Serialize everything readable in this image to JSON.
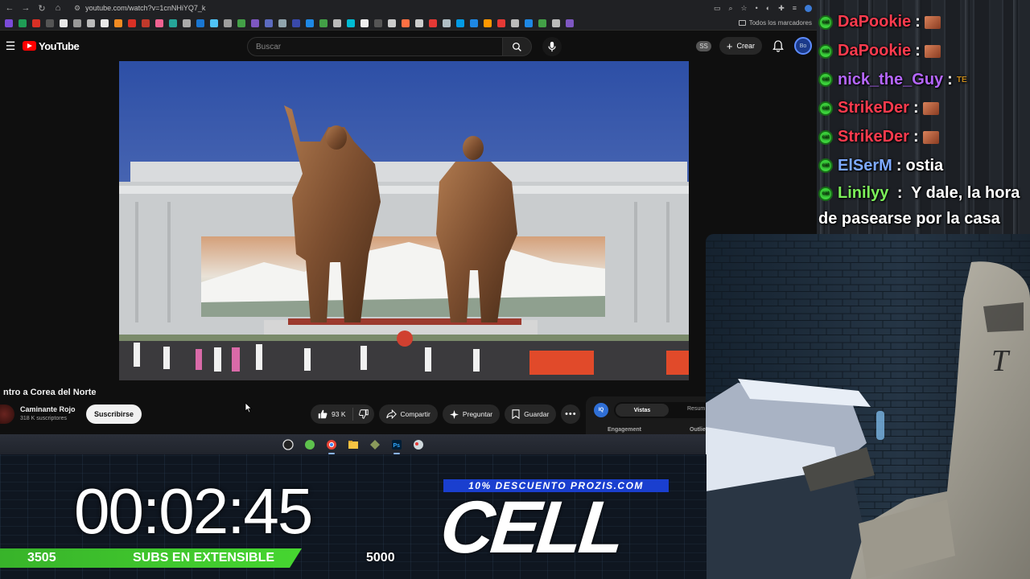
{
  "browser": {
    "url": "youtube.com/watch?v=1cnNHiYQ7_k",
    "bookmarks_folder": "Todos los marcadores"
  },
  "youtube": {
    "logo_text": "YouTube",
    "search_placeholder": "Buscar",
    "ss_badge": "SS",
    "create_label": "Crear",
    "avatar_text": "Bo",
    "video_title": "ntro a Corea del Norte",
    "channel": {
      "name": "Caminante Rojo",
      "subscribers": "318 K suscriptores",
      "subscribe_label": "Suscribirse"
    },
    "actions": {
      "likes": "93 K",
      "share": "Compartir",
      "ask": "Preguntar",
      "save": "Guardar",
      "more": "•••"
    },
    "side_panel": {
      "iq": "IQ",
      "tab_active": "Vistas",
      "tab_other": "Resum",
      "col1": "Engagement",
      "col2": "Outlie"
    }
  },
  "chat": {
    "messages": [
      {
        "user": "DaPookie",
        "color": "#ff3b4e",
        "text": "",
        "emote": "emote"
      },
      {
        "user": "DaPookie",
        "color": "#ff3b4e",
        "text": "",
        "emote": "emote"
      },
      {
        "user": "nick_the_Guy",
        "color": "#b566ff",
        "text": "",
        "emote": "TE"
      },
      {
        "user": "StrikeDer",
        "color": "#ff3b4e",
        "text": "",
        "emote": "emote"
      },
      {
        "user": "StrikeDer",
        "color": "#ff3b4e",
        "text": "",
        "emote": "emote"
      },
      {
        "user": "ElSerM",
        "color": "#7da9ff",
        "text": "ostia",
        "emote": ""
      }
    ],
    "last": {
      "user": "Linilyy",
      "color": "#7cf05a",
      "text": "Y dale, la hora de pasearse por la casa"
    },
    "badge_text": "cat"
  },
  "overlay": {
    "timer": "00:02:45",
    "sub_current": "3505",
    "sub_label": "SUBS EN EXTENSIBLE",
    "sub_goal": "5000",
    "sub_progress": 0.701,
    "promo": "10% DESCUENTO PROZIS.COM",
    "brand": "CELL"
  },
  "colors": {
    "yt_red": "#ff0000",
    "goal_green": "#42c92e",
    "promo_blue": "#1a3fcf"
  }
}
